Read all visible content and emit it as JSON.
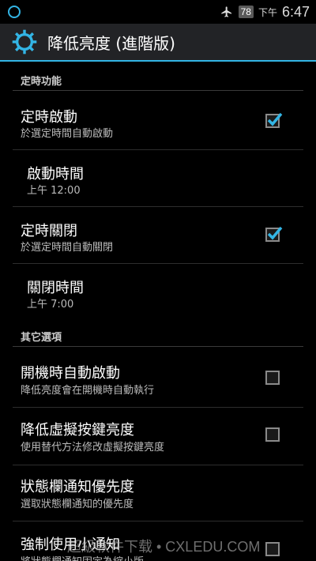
{
  "statusbar": {
    "battery": "78",
    "time_prefix": "下午",
    "time": "6:47"
  },
  "actionbar": {
    "title": "降低亮度 (進階版)"
  },
  "sections": {
    "timer_header": "定時功能",
    "other_header": "其它選項"
  },
  "prefs": {
    "timer_on": {
      "title": "定時啟動",
      "summary": "於選定時間自動啟動",
      "checked": true
    },
    "on_time": {
      "title": "啟動時間",
      "summary": "上午 12:00"
    },
    "timer_off": {
      "title": "定時關閉",
      "summary": "於選定時間自動關閉",
      "checked": true
    },
    "off_time": {
      "title": "關閉時間",
      "summary": "上午 7:00"
    },
    "boot_start": {
      "title": "開機時自動啟動",
      "summary": "降低亮度會在開機時自動執行",
      "checked": false
    },
    "dim_keys": {
      "title": "降低虛擬按鍵亮度",
      "summary": "使用替代方法修改虛擬按鍵亮度",
      "checked": false
    },
    "notif_priority": {
      "title": "狀態欄通知優先度",
      "summary": "選取狀態欄通知的優先度"
    },
    "small_notif": {
      "title": "強制使用小通知",
      "summary": "將狀態欄通知固定為縮小版",
      "checked": false
    }
  },
  "watermark": "超級軟件下载 • CXLEDU.COM",
  "colors": {
    "accent": "#33b5e5",
    "actionbar": "#222326",
    "background": "#000000"
  },
  "icons": [
    "notification-ring-icon",
    "airplane-icon",
    "battery-icon",
    "gear-icon",
    "checkbox-checked-icon"
  ]
}
